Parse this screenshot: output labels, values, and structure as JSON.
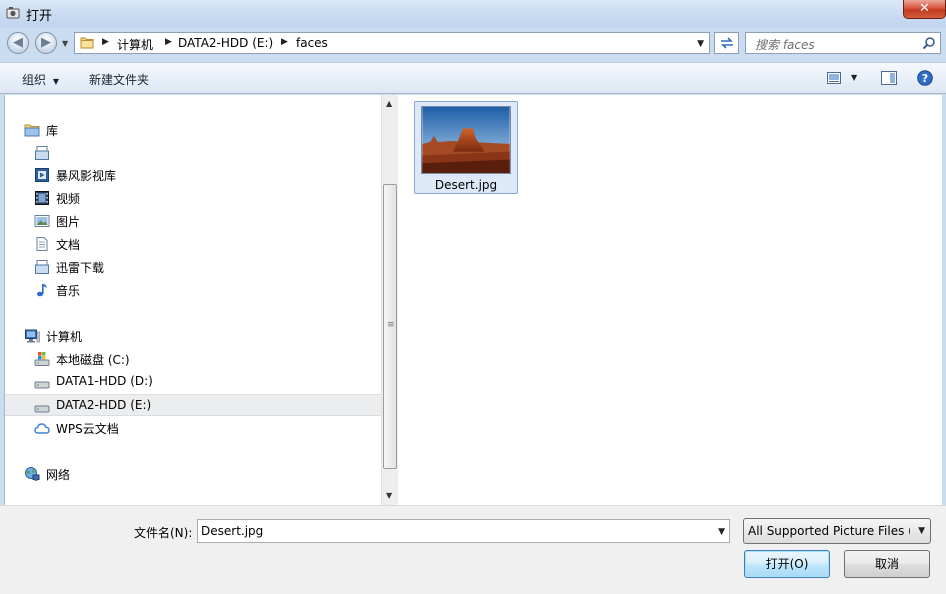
{
  "window": {
    "title": "打开",
    "close_label": "✕"
  },
  "address": {
    "breadcrumbs": [
      "计算机",
      "DATA2-HDD (E:)",
      "faces"
    ]
  },
  "search": {
    "placeholder": "搜索 faces"
  },
  "toolbar": {
    "organize": "组织",
    "new_folder": "新建文件夹"
  },
  "sidebar": {
    "items": [
      {
        "label": "库",
        "icon": "library-icon"
      },
      {
        "label": "",
        "icon": "document-library-icon"
      },
      {
        "label": "暴风影视库",
        "icon": "media-library-icon"
      },
      {
        "label": "视频",
        "icon": "video-icon"
      },
      {
        "label": "图片",
        "icon": "picture-icon"
      },
      {
        "label": "文档",
        "icon": "document-icon"
      },
      {
        "label": "迅雷下载",
        "icon": "download-library-icon"
      },
      {
        "label": "音乐",
        "icon": "music-icon"
      },
      {
        "label": "计算机",
        "icon": "computer-icon"
      },
      {
        "label": "本地磁盘 (C:)",
        "icon": "system-drive-icon"
      },
      {
        "label": "DATA1-HDD (D:)",
        "icon": "drive-icon"
      },
      {
        "label": "DATA2-HDD (E:)",
        "icon": "drive-icon",
        "selected": true
      },
      {
        "label": "WPS云文档",
        "icon": "cloud-icon"
      },
      {
        "label": "网络",
        "icon": "network-icon"
      }
    ]
  },
  "files": [
    {
      "name": "Desert.jpg",
      "selected": true
    }
  ],
  "bottom": {
    "filename_label": "文件名(N):",
    "filename_value": "Desert.jpg",
    "filetype_value": "All Supported Picture Files (*",
    "open_label": "打开(O)",
    "cancel_label": "取消"
  }
}
